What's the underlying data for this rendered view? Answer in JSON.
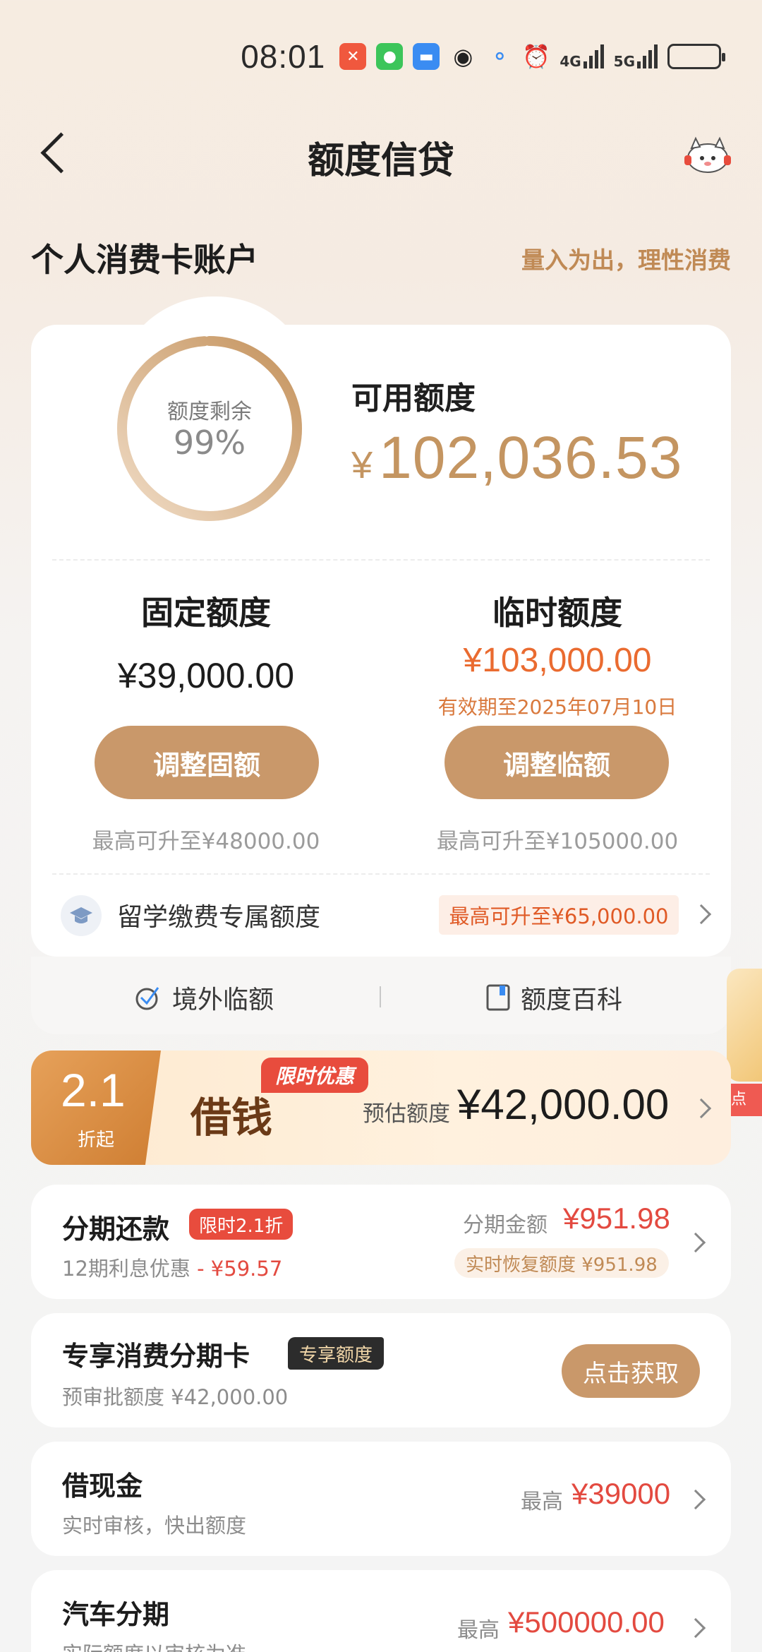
{
  "status_bar": {
    "time": "08:01",
    "icons": [
      "lightning-app-icon",
      "wechat-icon",
      "message-icon",
      "qq-icon",
      "chat-bubble-icon",
      "alarm-icon"
    ],
    "network1": "4G",
    "network2": "5G",
    "battery_level": 1.0
  },
  "nav": {
    "title": "额度信贷"
  },
  "section": {
    "title": "个人消费卡账户",
    "slogan": "量入为出，理性消费"
  },
  "quota_card": {
    "ring_label": "额度剩余",
    "ring_percent": "99%",
    "ring_fraction": 0.99,
    "available_label": "可用额度",
    "available_currency": "¥",
    "available_value": "102,036.53",
    "fixed": {
      "title": "固定额度",
      "value": "¥39,000.00",
      "button": "调整固额",
      "max": "最高可升至¥48000.00"
    },
    "temporary": {
      "title": "临时额度",
      "value": "¥103,000.00",
      "valid_until": "有效期至2025年07月10日",
      "button": "调整临额",
      "max": "最高可升至¥105000.00"
    },
    "study": {
      "label": "留学缴费专属额度",
      "tag": "最高可升至¥65,000.00"
    }
  },
  "sub_links": {
    "overseas": "境外临额",
    "wiki": "额度百科"
  },
  "side_float": {
    "text": "点"
  },
  "promo": {
    "discount": "2.1",
    "discount_sub": "折起",
    "tag": "限时优惠",
    "title": "借钱",
    "est_label": "预估额度",
    "est_value": "¥42,000.00"
  },
  "installment": {
    "title": "分期还款",
    "tag": "限时2.1折",
    "sub_prefix": "12期利息优惠",
    "sub_value": "- ¥59.57",
    "amount_label": "分期金额",
    "amount_value": "¥951.98",
    "restore": "实时恢复额度 ¥951.98"
  },
  "exclusive_card": {
    "title": "专享消费分期卡",
    "tag": "专享额度",
    "sub": "预审批额度 ¥42,000.00",
    "button": "点击获取"
  },
  "cash": {
    "title": "借现金",
    "sub": "实时审核，快出额度",
    "max_label": "最高",
    "max_value": "¥39000"
  },
  "car": {
    "title": "汽车分期",
    "sub": "实际额度以审核为准",
    "max_label": "最高",
    "max_value": "¥500000.00"
  },
  "colors": {
    "accent_gold": "#c9986a",
    "accent_orange": "#ea6b30",
    "accent_red": "#e34a40"
  }
}
